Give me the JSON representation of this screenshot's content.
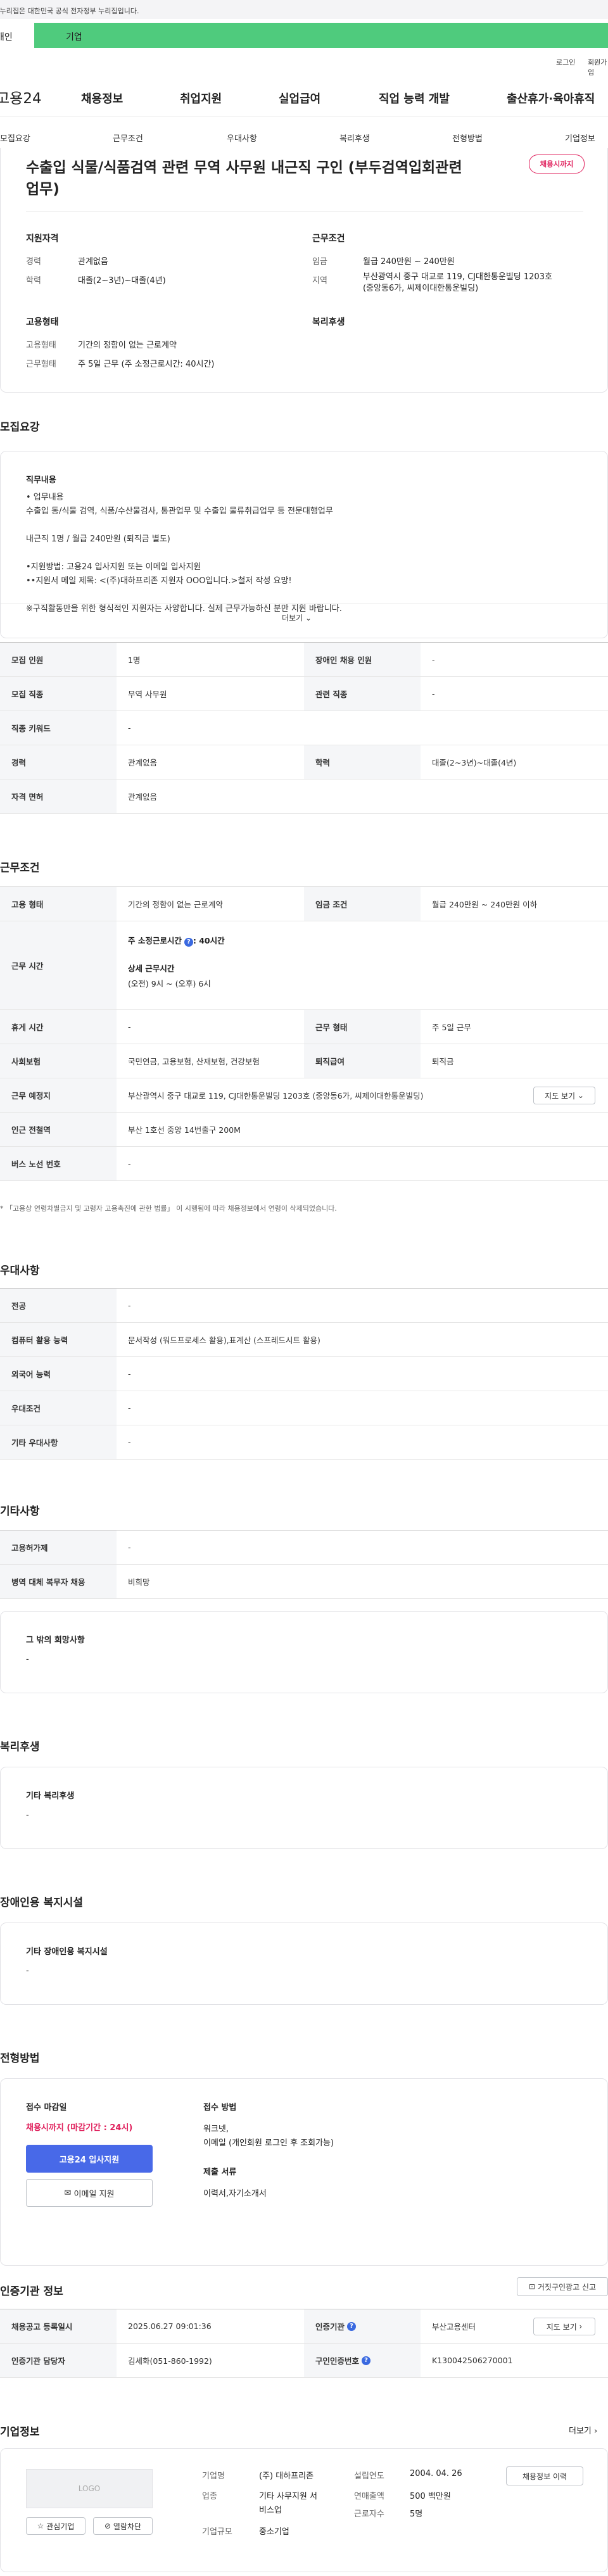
{
  "top_notice": "이 누리집은 대한민국 공식 전자정부 누리집입니다.",
  "sector_tabs": {
    "personal": "개인",
    "business": "기업"
  },
  "util": {
    "login": "로그인",
    "signup": "회원가입"
  },
  "brand": {
    "logo_main": "고용",
    "logo_num": "24"
  },
  "gnb": [
    "채용정보",
    "취업지원",
    "실업급여",
    "직업 능력 개발",
    "출산휴가·육아휴직"
  ],
  "subnav": [
    "모집요강",
    "근무조건",
    "우대사항",
    "복리후생",
    "전형방법",
    "기업정보"
  ],
  "summary": {
    "title": "수출입 식물/식품검역 관련 무역 사무원 내근직 구인 (부두검역입회관련업무)",
    "status_badge": "채용시까지",
    "qual_title": "지원자격",
    "career_label": "경력",
    "career_value": "관계없음",
    "edu_label": "학력",
    "edu_value": "대졸(2~3년)~대졸(4년)",
    "work_title": "근무조건",
    "wage_label": "임금",
    "wage_value": "월급 240만원 ~ 240만원",
    "area_label": "지역",
    "area_value_1": "부산광역시 중구 대교로 119, CJ대한통운빌딩 1203호",
    "area_value_2": "(중앙동6가, 씨제이대한통운빌딩)",
    "emp_title": "고용형태",
    "emp_type_label": "고용형태",
    "emp_type_value": "기간의 정함이 없는 근로계약",
    "work_form_label": "근무형태",
    "work_form_value": "주 5일 근무 (주 소정근로시간: 40시간)",
    "welfare_title": "복리후생"
  },
  "recruit": {
    "section_title": "모집요강",
    "detail_label": "직무내용",
    "detail_text": "• 업무내용\n수출입 동/식물 검역, 식품/수산물검사, 통관업무 및 수출입 물류취급업무 등 전문대행업무\n\n내근직 1명 / 월급 240만원 (퇴직금 별도)\n\n•지원방법: 고용24 입사지원 또는 이메일 입사지원\n••지원서 메일 제목: <(주)대하프리존 지원자 OOO입니다.>철저 작성 요망!\n\n※구직활동만을 위한 형식적인 지원자는 사양합니다. 실제 근무가능하신 분만 지원 바랍니다.",
    "more_label": "더보기",
    "rows": [
      {
        "h1": "모집 인원",
        "v1": "1명",
        "h2": "장애인 채용 인원",
        "v2": "-"
      },
      {
        "h1": "모집 직종",
        "v1": "무역 사무원",
        "h2": "관련 직종",
        "v2": "-"
      },
      {
        "h1": "직종 키워드",
        "v1": "-"
      },
      {
        "h1": "경력",
        "v1": "관계없음",
        "h2": "학력",
        "v2": "대졸(2~3년)~대졸(4년)"
      },
      {
        "h1": "자격 면허",
        "v1": "관계없음"
      }
    ]
  },
  "conditions": {
    "section_title": "근무조건",
    "emp_label": "고용 형태",
    "emp_value": "기간의 정함이 없는 근로계약",
    "wage_label": "임금 조건",
    "wage_value": "월급 240만원 ~ 240만원 이하",
    "hours_label": "근무 시간",
    "hours_weekly_label": "주 소정근로시간",
    "hours_weekly_value": ": 40시간",
    "hours_detail_label": "상세 근무시간",
    "hours_detail_value": "(오전) 9시 ~ (오후) 6시",
    "break_label": "휴게 시간",
    "break_value": "-",
    "form_label": "근무 형태",
    "form_value": "주 5일 근무",
    "insurance_label": "사회보험",
    "insurance_value": "국민연금, 고용보험, 산재보험, 건강보험",
    "severance_label": "퇴직급여",
    "severance_value": "퇴직금",
    "place_label": "근무 예정지",
    "place_value": "부산광역시 중구 대교로 119, CJ대한통운빌딩 1203호 (중앙동6가, 씨제이대한통운빌딩)",
    "map_button": "지도 보기",
    "subway_label": "인근 전철역",
    "subway_value": "부산 1호선 중앙 14번출구 200M",
    "bus_label": "버스 노선 번호",
    "bus_value": "-",
    "note": "* 「고용상 연령차별금지 및 고령자 고용촉진에 관한 법률」 이 시행됨에 따라 채용정보에서 연령이 삭제되었습니다."
  },
  "preference": {
    "section_title": "우대사항",
    "rows": [
      {
        "h": "전공",
        "v": "-"
      },
      {
        "h": "컴퓨터 활용 능력",
        "v": "문서작성 (워드프로세스 활용),표계산 (스프레드시트 활용)"
      },
      {
        "h": "외국어 능력",
        "v": "-"
      },
      {
        "h": "우대조건",
        "v": "-"
      },
      {
        "h": "기타 우대사항",
        "v": "-"
      }
    ]
  },
  "etc": {
    "section_title": "기타사항",
    "rows": [
      {
        "h": "고용허가제",
        "v": "-"
      },
      {
        "h": "병역 대체 복무자 채용",
        "v": "비희망"
      }
    ],
    "other_label": "그 밖의 희망사항",
    "other_value": "-"
  },
  "welfare": {
    "section_title": "복리후생",
    "label": "기타 복리후생",
    "value": "-"
  },
  "disability": {
    "section_title": "장애인용 복지시설",
    "label": "기타 장애인용 복지시설",
    "value": "-"
  },
  "process": {
    "section_title": "전형방법",
    "deadline_label": "접수 마감일",
    "deadline_value": "채용시까지 (마감기간 : 24시)",
    "apply_button": "고용24 입사지원",
    "email_button": "이메일 지원",
    "method_label": "접수 방법",
    "method_value_1": "워크넷,",
    "method_value_2": "이메일 (개인회원 로그인 후 조회가능)",
    "docs_label": "제출 서류",
    "docs_value": "이력서,자기소개서"
  },
  "cert": {
    "section_title": "인증기관 정보",
    "report_button": "거짓구인광고 신고",
    "rows": [
      {
        "h1": "채용공고 등록일시",
        "v1": "2025.06.27 09:01:36",
        "h2": "인증기관",
        "v2": "부산고용센터"
      },
      {
        "h1": "인증기관 담당자",
        "v1": "김세화(051-860-1992)",
        "h2": "구인인증번호",
        "v2": "K130042506270001"
      }
    ],
    "map_button": "지도 보기"
  },
  "company": {
    "section_title": "기업정보",
    "more": "더보기",
    "logo_placeholder": "LOGO",
    "fav_button": "관심기업",
    "block_button": "열람차단",
    "name_label": "기업명",
    "name_value": "(주) 대하프리존",
    "industry_label": "업종",
    "industry_value_1": "기타 사무지원 서",
    "industry_value_2": "비스업",
    "size_label": "기업규모",
    "size_value": "중소기업",
    "founded_label": "설립연도",
    "founded_value": "2004. 04. 26",
    "sales_label": "연매출액",
    "sales_value": "500 백만원",
    "employees_label": "근로자수",
    "employees_value": "5명",
    "jobs_button": "채용정보 이력"
  },
  "colors": {
    "accent": "#1e6ae0",
    "sector_green": "#4fcb7d",
    "badge_pink": "#e0215d",
    "apply_blue": "#4869e8"
  }
}
